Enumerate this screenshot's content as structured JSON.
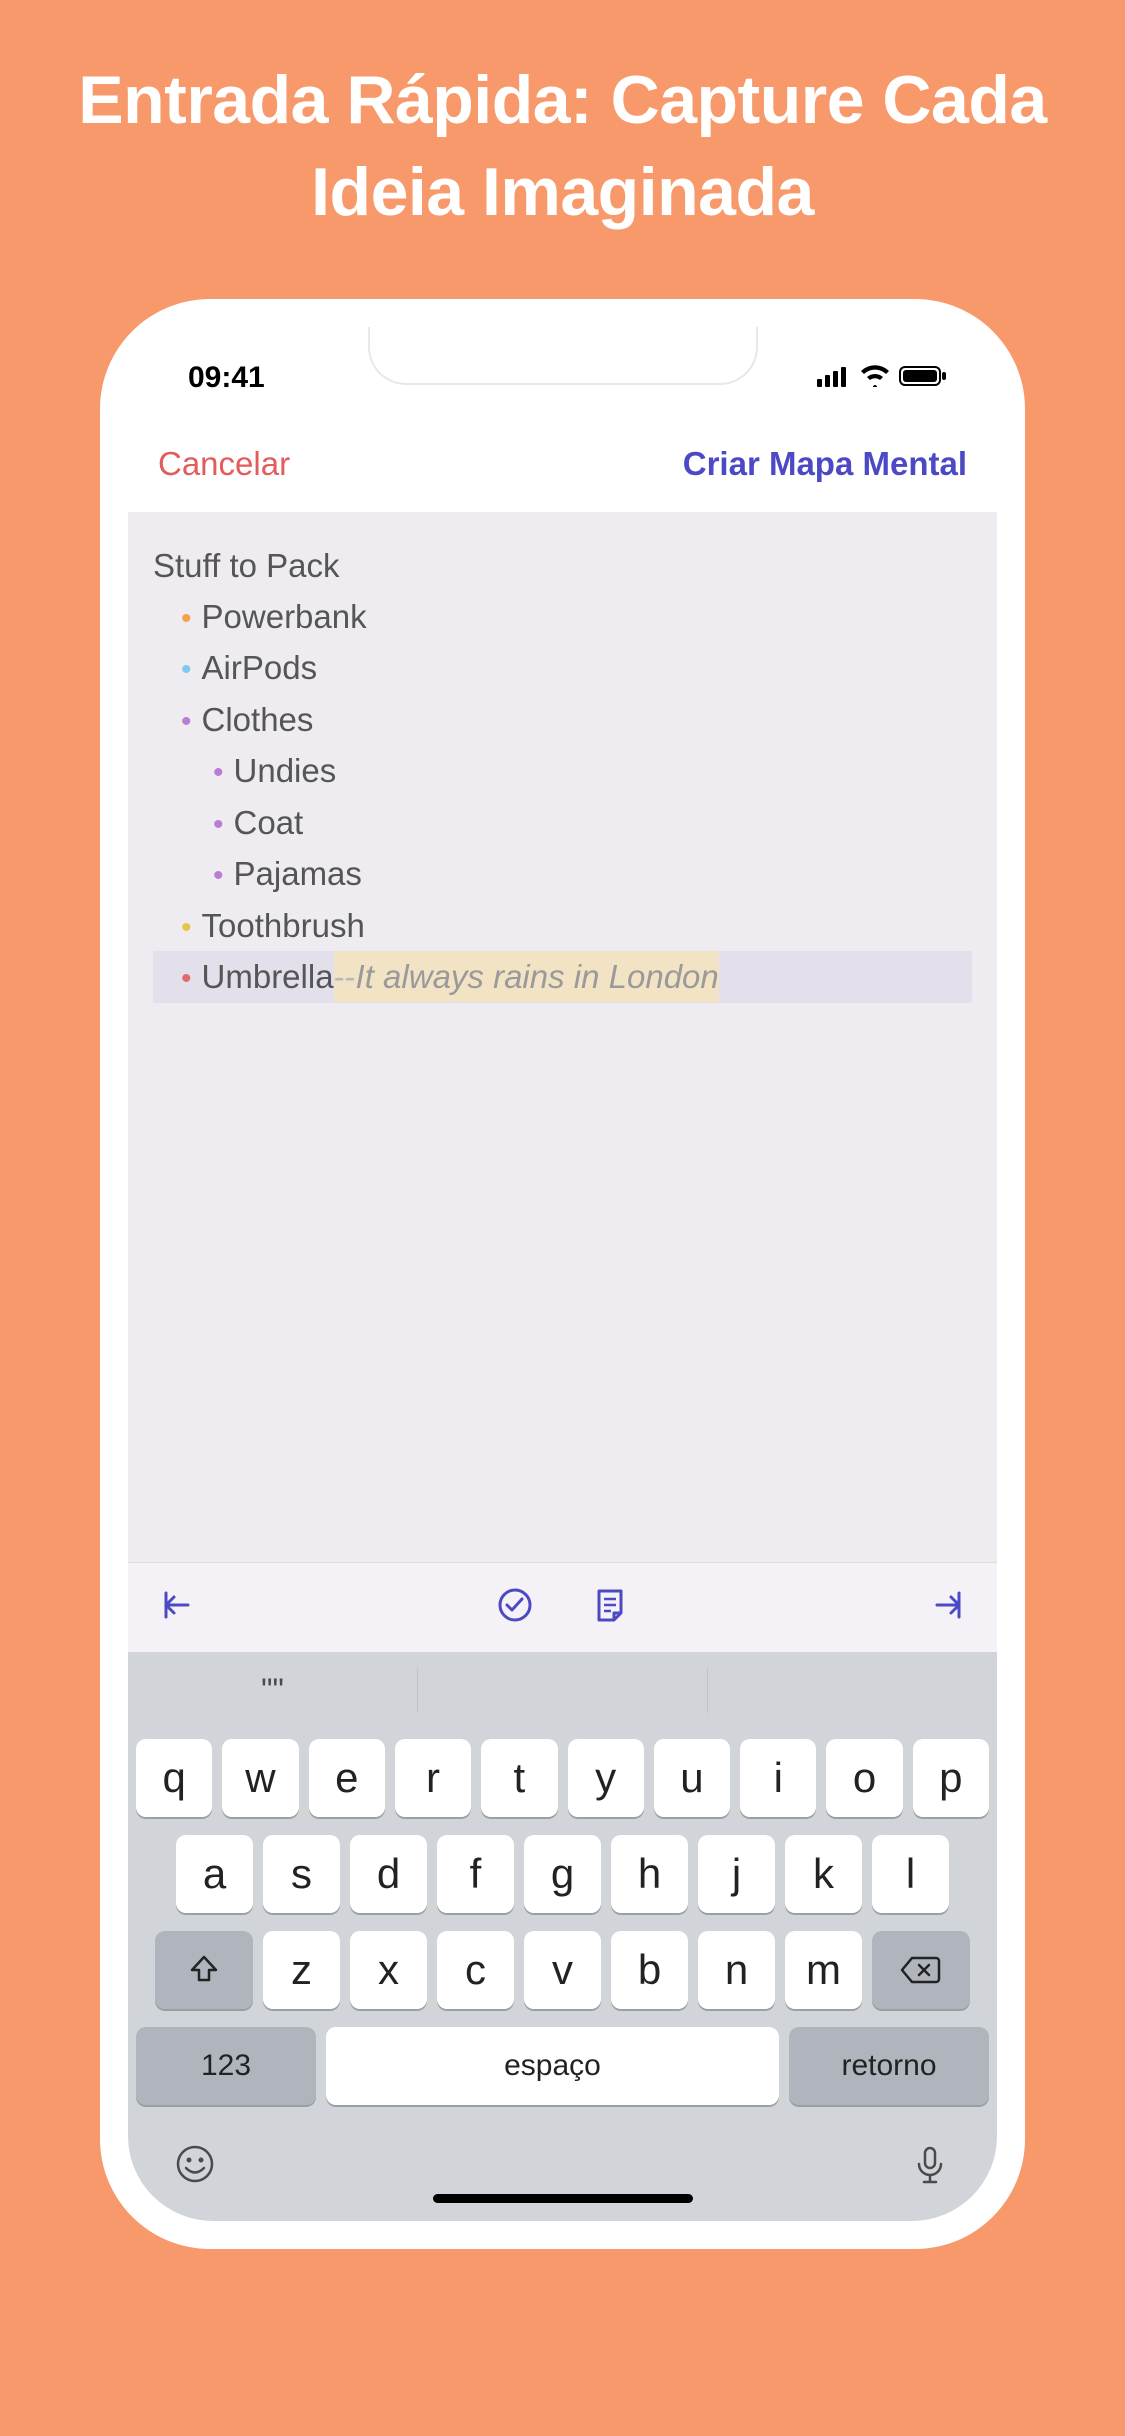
{
  "promo": {
    "title_line1": "Entrada Rápida: Capture Cada",
    "title_line2": "Ideia Imaginada"
  },
  "status": {
    "time": "09:41"
  },
  "nav": {
    "cancel": "Cancelar",
    "create": "Criar Mapa Mental"
  },
  "editor": {
    "title": "Stuff to Pack",
    "items": [
      {
        "bullet": "orange",
        "text": "Powerbank",
        "indent": 1
      },
      {
        "bullet": "blue",
        "text": "AirPods",
        "indent": 1
      },
      {
        "bullet": "purple",
        "text": "Clothes",
        "indent": 1
      },
      {
        "bullet": "purple",
        "text": "Undies",
        "indent": 2
      },
      {
        "bullet": "purple",
        "text": "Coat",
        "indent": 2
      },
      {
        "bullet": "purple",
        "text": "Pajamas",
        "indent": 2
      },
      {
        "bullet": "yellow",
        "text": "Toothbrush",
        "indent": 1
      }
    ],
    "selected": {
      "bullet": "red",
      "text": "Umbrella",
      "dash": " -- ",
      "note": "It always rains in London"
    }
  },
  "suggestions": [
    "\"\"",
    "",
    ""
  ],
  "keyboard": {
    "row1": [
      "q",
      "w",
      "e",
      "r",
      "t",
      "y",
      "u",
      "i",
      "o",
      "p"
    ],
    "row2": [
      "a",
      "s",
      "d",
      "f",
      "g",
      "h",
      "j",
      "k",
      "l"
    ],
    "row3": [
      "z",
      "x",
      "c",
      "v",
      "b",
      "n",
      "m"
    ],
    "numbers": "123",
    "space": "espaço",
    "return": "retorno"
  }
}
